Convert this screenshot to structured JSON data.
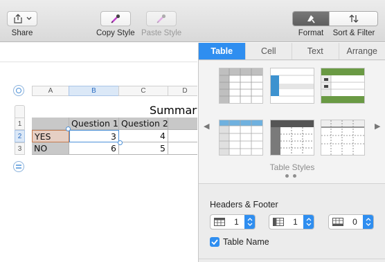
{
  "toolbar": {
    "share_label": "Share",
    "copy_style_label": "Copy Style",
    "paste_style_label": "Paste Style",
    "format_label": "Format",
    "sort_filter_label": "Sort & Filter"
  },
  "sheet": {
    "columns": [
      "A",
      "B",
      "C",
      "D"
    ],
    "selected_column": "B",
    "rows": [
      "1",
      "2",
      "3"
    ],
    "selected_row": "2",
    "table_title": "Summary",
    "header_row": [
      "",
      "Question 1",
      "Question 2",
      ""
    ],
    "data_rows": [
      [
        "YES",
        "3",
        "4",
        ""
      ],
      [
        "NO",
        "6",
        "5",
        ""
      ]
    ]
  },
  "inspector": {
    "tabs": [
      "Table",
      "Cell",
      "Text",
      "Arrange"
    ],
    "active_tab": "Table",
    "styles_label": "Table Styles",
    "headers_footer_title": "Headers & Footer",
    "header_rows_value": "1",
    "header_columns_value": "1",
    "footer_rows_value": "0",
    "table_name_label": "Table Name",
    "table_name_checked": true
  },
  "colors": {
    "accent": "#2f8ef0",
    "selection_blue": "#dbe8f7",
    "header_gray": "#c8c8c8",
    "yes_cell_fill": "#e6cfc4",
    "green_style": "#6a9a44",
    "blue_style": "#3d92cf"
  }
}
